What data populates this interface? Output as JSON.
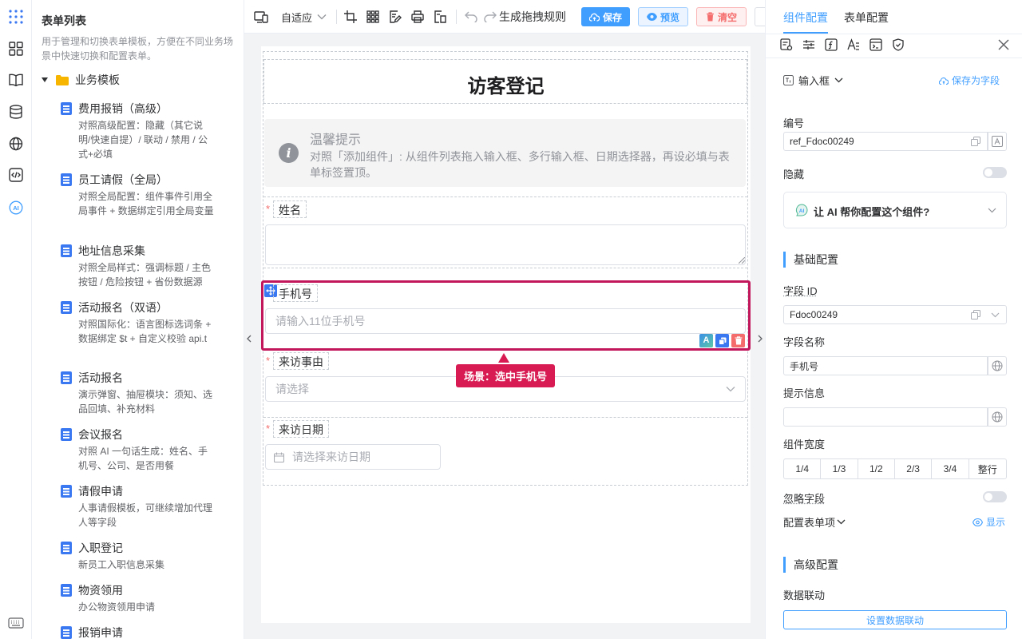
{
  "sidebar_rail": {
    "icons": [
      "apps-grid-icon",
      "widgets-icon",
      "book-icon",
      "database-icon",
      "globe-icon",
      "code-icon",
      "ai-icon",
      "keyboard-icon"
    ]
  },
  "form_list": {
    "title": "表单列表",
    "description": "用于管理和切换表单模板，方便在不同业务场景中快速切换和配置表单。",
    "folder": "业务模板",
    "templates": [
      {
        "name": "费用报销（高级）",
        "desc": "对照高级配置：隐藏（其它说明/快速自提）/ 联动 / 禁用 / 公式+必填"
      },
      {
        "name": "员工请假（全局）",
        "desc": "对照全局配置：组件事件引用全局事件 + 数据绑定引用全局变量"
      },
      {
        "name": "地址信息采集",
        "desc": "对照全局样式：强调标题 / 主色按钮 / 危险按钮 + 省份数据源"
      },
      {
        "name": "活动报名（双语）",
        "desc": "对照国际化：语言图标选词条 + 数据绑定 $t + 自定义校验 api.t"
      },
      {
        "name": "活动报名",
        "desc": "演示弹窗、抽屉模块：须知、选品回填、补充材料"
      },
      {
        "name": "会议报名",
        "desc": "对照 AI 一句话生成：姓名、手机号、公司、是否用餐"
      },
      {
        "name": "请假申请",
        "desc": "人事请假模板，可继续增加代理人等字段"
      },
      {
        "name": "入职登记",
        "desc": "新员工入职信息采集"
      },
      {
        "name": "物资领用",
        "desc": "办公物资领用申请"
      },
      {
        "name": "报销申请",
        "desc": ""
      }
    ]
  },
  "toolbar": {
    "fit_label": "自适应",
    "rules_label": "生成拖拽规则",
    "save_label": "保存",
    "preview_label": "预览",
    "clear_label": "清空"
  },
  "form": {
    "title": "访客登记",
    "tip_title": "温馨提示",
    "tip_text": "对照「添加组件」: 从组件列表拖入输入框、多行输入框、日期选择器，再设必填与表单标签置顶。",
    "name_label": "姓名",
    "phone_label": "手机号",
    "phone_placeholder": "请输入11位手机号",
    "reason_label": "来访事由",
    "reason_placeholder": "请选择",
    "date_label": "来访日期",
    "date_placeholder": "请选择来访日期",
    "scene_badge": "场景：选中手机号"
  },
  "right_panel": {
    "tabs": [
      "组件配置",
      "表单配置"
    ],
    "active_tab": "组件配置",
    "component_type": "输入框",
    "save_as_field": "保存为字段",
    "id_label": "编号",
    "id_value": "ref_Fdoc00249",
    "hidden_label": "隐藏",
    "ai_prompt": "让 AI 帮你配置这个组件?",
    "basic_section": "基础配置",
    "field_id_label": "字段 ID",
    "field_id_value": "Fdoc00249",
    "field_name_label": "字段名称",
    "field_name_value": "手机号",
    "hint_label": "提示信息",
    "hint_value": "",
    "width_label": "组件宽度",
    "width_options": [
      "1/4",
      "1/3",
      "1/2",
      "2/3",
      "3/4",
      "整行"
    ],
    "ignore_label": "忽略字段",
    "items_label": "配置表单项",
    "show_label": "显示",
    "advanced_section": "高级配置",
    "linkage_label": "数据联动",
    "linkage_button": "设置数据联动"
  },
  "colors": {
    "primary": "#409eff",
    "selection": "#c2185b",
    "danger": "#f56c6c"
  }
}
